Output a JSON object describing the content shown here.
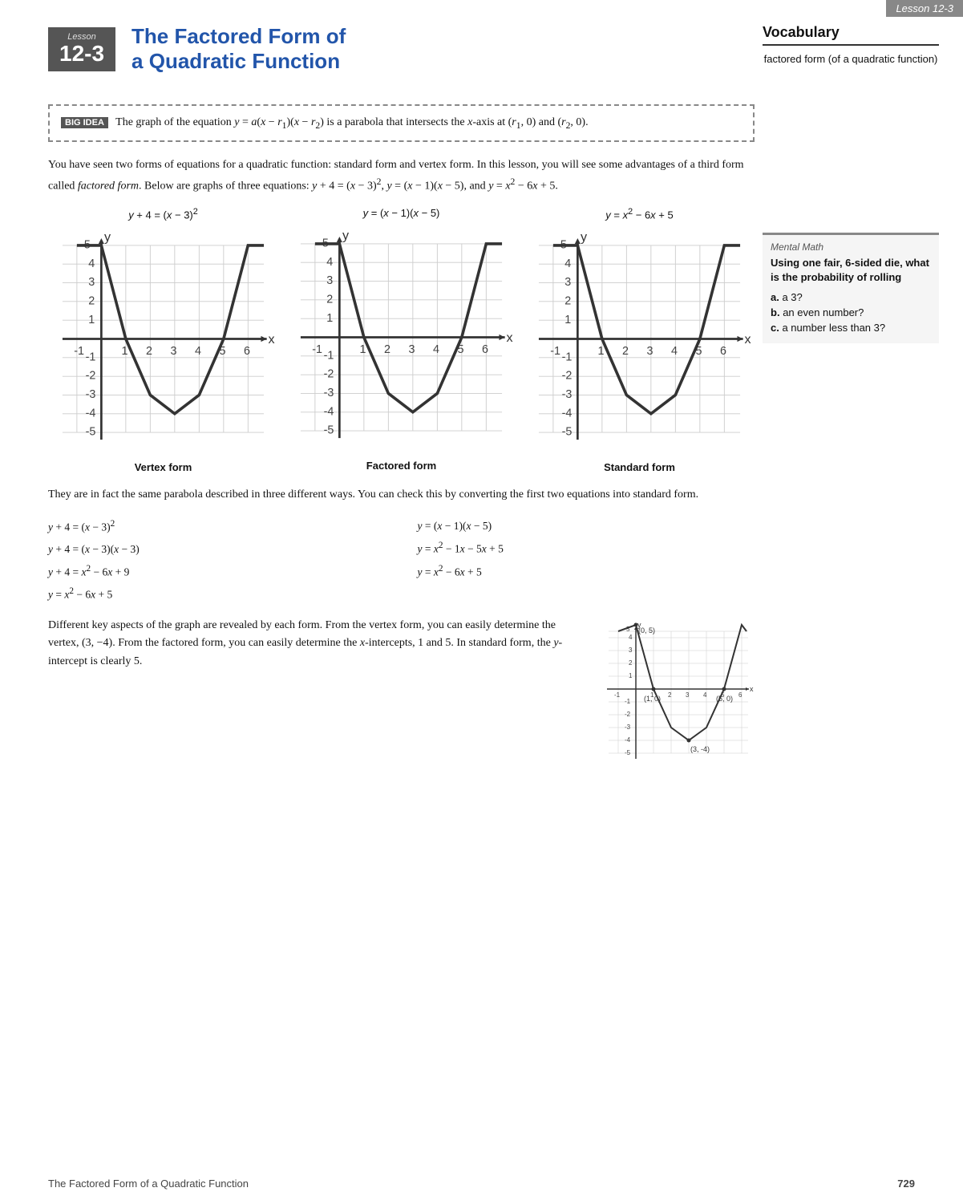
{
  "top_right": {
    "label": "Lesson 12-3"
  },
  "header": {
    "lesson_word": "Lesson",
    "lesson_number": "12-3",
    "title_line1": "The Factored Form of",
    "title_line2": "a Quadratic Function"
  },
  "vocabulary": {
    "title": "Vocabulary",
    "term": "factored form (of a quadratic function)"
  },
  "big_idea": {
    "label": "BIG IDEA",
    "text": "The graph of the equation y = a(x − r₁)(x − r₂) is a parabola that intersects the x-axis at (r₁, 0) and (r₂, 0)."
  },
  "body_paragraph": "You have seen two forms of equations for a quadratic function: standard form and vertex form. In this lesson, you will see some advantages of a third form called factored form. Below are graphs of three equations: y + 4 = (x − 3)², y = (x − 1)(x − 5), and y = x² − 6x + 5.",
  "graphs": [
    {
      "label_top": "y + 4 = (x − 3)²",
      "label_bottom": "Vertex form"
    },
    {
      "label_top": "y = (x − 1)(x − 5)",
      "label_bottom": "Factored form"
    },
    {
      "label_top": "y = x² − 6x + 5",
      "label_bottom": "Standard form"
    }
  ],
  "body_paragraph2": "They are in fact the same parabola described in three different ways. You can check this by converting the first two equations into standard form.",
  "equations_left": [
    "y + 4 = (x − 3)²",
    "y + 4 = (x − 3)(x − 3)",
    "y + 4 = x² − 6x + 9",
    "y = x² − 6x + 5"
  ],
  "equations_right": [
    "y = (x − 1)(x − 5)",
    "y = x² − 1x − 5x + 5",
    "y = x² − 6x + 5"
  ],
  "body_paragraph3": "Different key aspects of the graph are revealed by each form. From the vertex form, you can easily determine the vertex, (3, −4). From the factored form, you can easily determine the x-intercepts, 1 and 5. In standard form, the y-intercept is clearly 5.",
  "mental_math": {
    "title": "Mental Math",
    "heading": "Using one fair, 6-sided die, what is the probability of rolling",
    "questions": [
      {
        "label": "a.",
        "text": "a 3?"
      },
      {
        "label": "b.",
        "text": "an even number?"
      },
      {
        "label": "c.",
        "text": "a number less than 3?"
      }
    ]
  },
  "footer": {
    "left": "The Factored Form of a Quadratic Function",
    "right": "729"
  }
}
